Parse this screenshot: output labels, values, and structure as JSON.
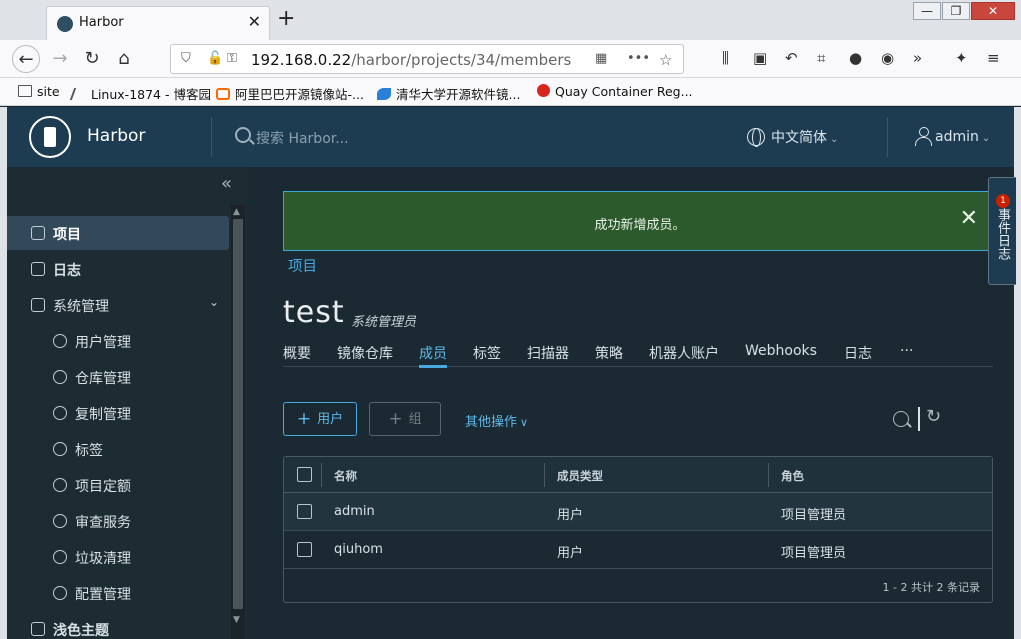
{
  "browser": {
    "tab_title": "Harbor",
    "tab_close": "✕",
    "new_tab": "+",
    "url_host": "192.168.0.22",
    "url_path": "/harbor/projects/34/members",
    "bookmarks": [
      {
        "label": "site",
        "color": "#6b6b6b"
      },
      {
        "label": "Linux-1874 - 博客园",
        "color": "#555"
      },
      {
        "label": "阿里巴巴开源镜像站-...",
        "color": "#ff6a00"
      },
      {
        "label": "清华大学开源软件镜...",
        "color": "#2a7fd6"
      },
      {
        "label": "Quay Container Reg...",
        "color": "#d9261c"
      }
    ]
  },
  "header": {
    "brand": "Harbor",
    "search_placeholder": "搜索 Harbor...",
    "language": "中文简体",
    "user": "admin"
  },
  "sidebar": {
    "items": [
      {
        "label": "项目",
        "level": "top",
        "active": true,
        "icon": "projects-icon"
      },
      {
        "label": "日志",
        "level": "top",
        "active": false,
        "icon": "logs-icon"
      },
      {
        "label": "系统管理",
        "level": "top",
        "active": false,
        "icon": "admin-icon",
        "expanded": true
      },
      {
        "label": "用户管理",
        "level": "sub",
        "icon": "users-icon"
      },
      {
        "label": "仓库管理",
        "level": "sub",
        "icon": "registries-icon"
      },
      {
        "label": "复制管理",
        "level": "sub",
        "icon": "replication-icon"
      },
      {
        "label": "标签",
        "level": "sub",
        "icon": "tag-icon"
      },
      {
        "label": "项目定额",
        "level": "sub",
        "icon": "quota-icon"
      },
      {
        "label": "审查服务",
        "level": "sub",
        "icon": "shield-icon"
      },
      {
        "label": "垃圾清理",
        "level": "sub",
        "icon": "trash-icon"
      },
      {
        "label": "配置管理",
        "level": "sub",
        "icon": "gear-icon"
      },
      {
        "label": "浅色主题",
        "level": "top",
        "icon": "theme-icon"
      }
    ]
  },
  "alert": {
    "message": "成功新增成员。",
    "close": "✕"
  },
  "breadcrumb": "项目",
  "project": {
    "name": "test",
    "role": "系统管理员"
  },
  "tabs": [
    {
      "label": "概要"
    },
    {
      "label": "镜像仓库"
    },
    {
      "label": "成员",
      "active": true
    },
    {
      "label": "标签"
    },
    {
      "label": "扫描器"
    },
    {
      "label": "策略"
    },
    {
      "label": "机器人账户"
    },
    {
      "label": "Webhooks"
    },
    {
      "label": "日志"
    },
    {
      "label": "···"
    }
  ],
  "toolbar": {
    "add_user": "用户",
    "add_group": "组",
    "more_actions": "其他操作"
  },
  "table": {
    "columns": [
      "名称",
      "成员类型",
      "角色"
    ],
    "rows": [
      {
        "name": "admin",
        "type": "用户",
        "role": "项目管理员"
      },
      {
        "name": "qiuhom",
        "type": "用户",
        "role": "项目管理员"
      }
    ],
    "footer": "1 - 2 共计 2 条记录"
  },
  "event_log": {
    "label": "事件日志",
    "count": "1"
  }
}
